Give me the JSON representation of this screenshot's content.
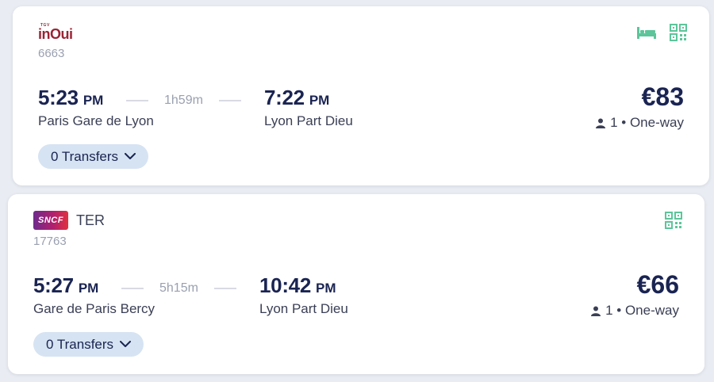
{
  "trips": [
    {
      "brand": {
        "logo_text": "inOui",
        "logo_small": "TGV",
        "type_label": ""
      },
      "train_number": "6663",
      "departure": {
        "time": "5:23",
        "ampm": "PM",
        "station": "Paris Gare de Lyon"
      },
      "duration": "1h59m",
      "arrival": {
        "time": "7:22",
        "ampm": "PM",
        "station": "Lyon Part Dieu"
      },
      "price": "€83",
      "passengers": "1 • One-way",
      "transfers_label": "0 Transfers",
      "icons": [
        "bed-icon",
        "qr-code-icon"
      ]
    },
    {
      "brand": {
        "logo_text": "SNCF",
        "type_label": "TER"
      },
      "train_number": "17763",
      "departure": {
        "time": "5:27",
        "ampm": "PM",
        "station": "Gare de Paris Bercy"
      },
      "duration": "5h15m",
      "arrival": {
        "time": "10:42",
        "ampm": "PM",
        "station": "Lyon Part Dieu"
      },
      "price": "€66",
      "passengers": "1 • One-way",
      "transfers_label": "0 Transfers",
      "icons": [
        "qr-code-icon"
      ]
    }
  ],
  "colors": {
    "accent_green": "#5cc59a",
    "text_dark": "#1a2452",
    "chip_bg": "#d6e3f2"
  }
}
